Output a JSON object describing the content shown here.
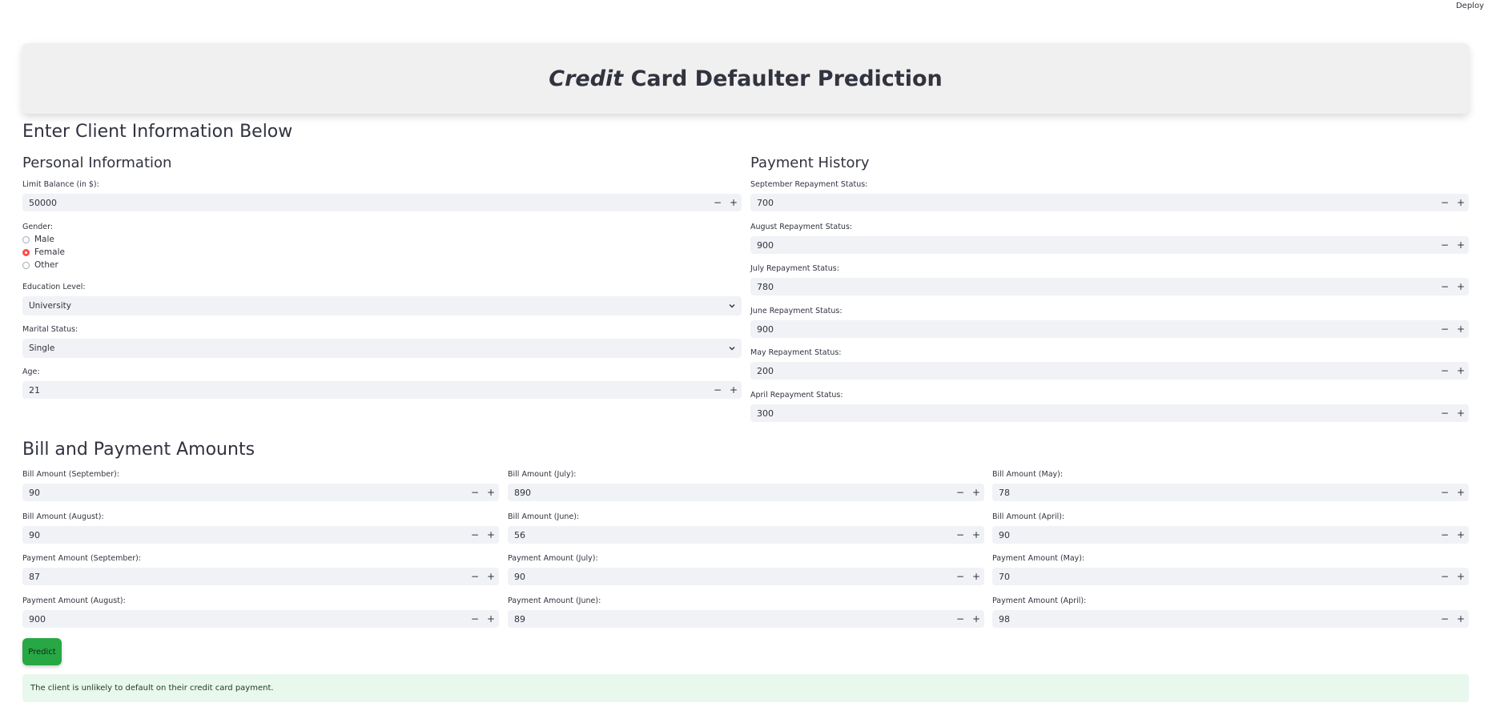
{
  "header": {
    "deploy_label": "Deploy"
  },
  "banner": {
    "title_italic": "Credit",
    "title_rest": " Card Defaulter Prediction"
  },
  "page": {
    "heading": "Enter Client Information Below"
  },
  "personal": {
    "heading": "Personal Information",
    "limit_label": "Limit Balance (in $):",
    "limit_value": "50000",
    "gender_label": "Gender:",
    "gender_options": [
      "Male",
      "Female",
      "Other"
    ],
    "gender_selected": "Female",
    "education_label": "Education Level:",
    "education_value": "University",
    "marital_label": "Marital Status:",
    "marital_value": "Single",
    "age_label": "Age:",
    "age_value": "21"
  },
  "payment_history": {
    "heading": "Payment History",
    "items": [
      {
        "label": "September Repayment Status:",
        "value": "700"
      },
      {
        "label": "August Repayment Status:",
        "value": "900"
      },
      {
        "label": "July Repayment Status:",
        "value": "780"
      },
      {
        "label": "June Repayment Status:",
        "value": "900"
      },
      {
        "label": "May Repayment Status:",
        "value": "200"
      },
      {
        "label": "April Repayment Status:",
        "value": "300"
      }
    ]
  },
  "amounts": {
    "heading": "Bill and Payment Amounts",
    "col1": [
      {
        "label": "Bill Amount (September):",
        "value": "90"
      },
      {
        "label": "Bill Amount (August):",
        "value": "90"
      },
      {
        "label": "Payment Amount (September):",
        "value": "87"
      },
      {
        "label": "Payment Amount (August):",
        "value": "900"
      }
    ],
    "col2": [
      {
        "label": "Bill Amount (July):",
        "value": "890"
      },
      {
        "label": "Bill Amount (June):",
        "value": "56"
      },
      {
        "label": "Payment Amount (July):",
        "value": "90"
      },
      {
        "label": "Payment Amount (June):",
        "value": "89"
      }
    ],
    "col3": [
      {
        "label": "Bill Amount (May):",
        "value": "78"
      },
      {
        "label": "Bill Amount (April):",
        "value": "90"
      },
      {
        "label": "Payment Amount (May):",
        "value": "70"
      },
      {
        "label": "Payment Amount (April):",
        "value": "98"
      }
    ]
  },
  "stepper": {
    "minus": "−",
    "plus": "+"
  },
  "predict_label": "Predict",
  "result_text": "The client is unlikely to default on their credit card payment."
}
